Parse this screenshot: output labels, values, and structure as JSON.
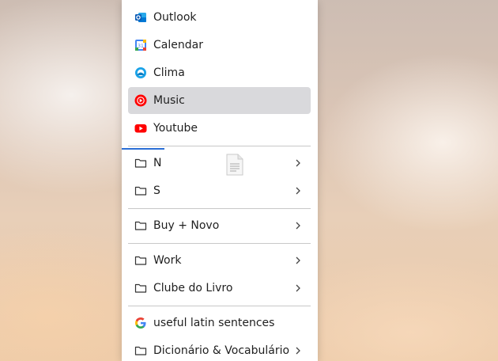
{
  "bookmarks_menu": {
    "apps": [
      {
        "label": "Outlook",
        "icon": "outlook-icon"
      },
      {
        "label": "Calendar",
        "icon": "google-calendar-icon"
      },
      {
        "label": "Clima",
        "icon": "weather-icon"
      },
      {
        "label": "Music",
        "icon": "youtube-music-icon",
        "highlighted": true
      },
      {
        "label": "Youtube",
        "icon": "youtube-icon"
      }
    ],
    "folders_1": [
      {
        "label": "N",
        "icon": "folder-icon"
      },
      {
        "label": "S",
        "icon": "folder-icon"
      }
    ],
    "folders_2": [
      {
        "label": "Buy + Novo",
        "icon": "folder-icon"
      }
    ],
    "folders_3": [
      {
        "label": "Work",
        "icon": "folder-icon"
      },
      {
        "label": "Clube do Livro",
        "icon": "folder-icon"
      }
    ],
    "links": [
      {
        "label": "useful latin sentences",
        "icon": "google-icon"
      },
      {
        "label": "Dicionário & Vocabulário",
        "icon": "folder-icon"
      }
    ]
  },
  "colors": {
    "highlight": "#d9d9dc",
    "drop_indicator": "#2b6fd6",
    "menu_background": "#ffffff"
  }
}
